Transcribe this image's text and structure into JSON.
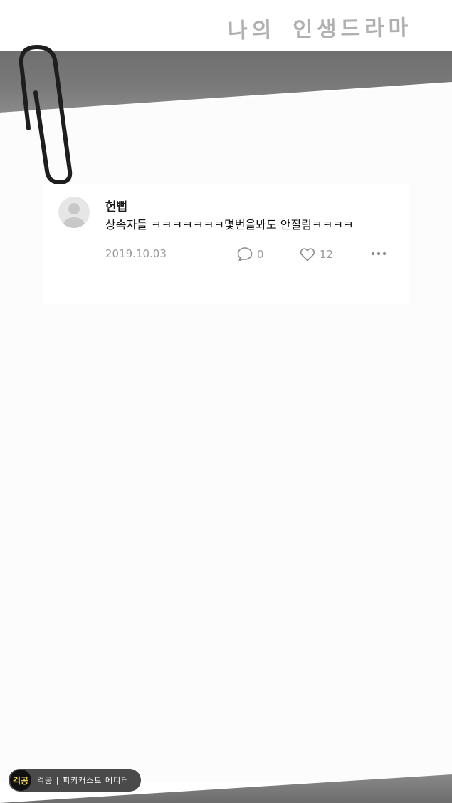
{
  "header": {
    "title": "나의 인생드라마"
  },
  "post": {
    "username": "헌뻡",
    "text": "상속자들 ㅋㅋㅋㅋㅋㅋㅋ몇번을봐도 안질림ㅋㅋㅋㅋ",
    "date": "2019.10.03",
    "comment_count": "0",
    "like_count": "12"
  },
  "watermark": {
    "logo": "걱공",
    "text": "걱공 | 피키캐스트 에디터"
  },
  "icons": {
    "comment": "comment-icon",
    "like": "heart-icon",
    "more": "more-dots-icon",
    "paperclip": "paperclip-icon",
    "avatar": "avatar-icon"
  },
  "colors": {
    "band": "#777777",
    "paper": "#fcfcfc",
    "meta_text": "#9a9a9a"
  }
}
